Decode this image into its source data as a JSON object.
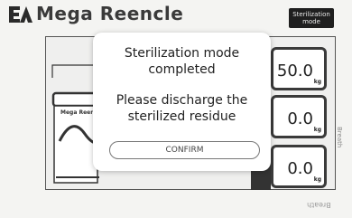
{
  "header": {
    "brand": "Mega Reencle",
    "mode_button_line1": "Sterilization",
    "mode_button_line2": "mode"
  },
  "display": {
    "values": [
      {
        "value": "50.0",
        "unit": "kg"
      },
      {
        "value": "0.0",
        "unit": "kg"
      },
      {
        "value": "0.0",
        "unit": "kg"
      }
    ],
    "machine_label": "Mega Reen",
    "side_text": "Breath",
    "bottom_text": "Breath"
  },
  "modal": {
    "title_line1": "Sterilization mode",
    "title_line2": "completed",
    "message_line1": "Please discharge the",
    "message_line2": "sterilized residue",
    "confirm_label": "CONFIRM"
  }
}
